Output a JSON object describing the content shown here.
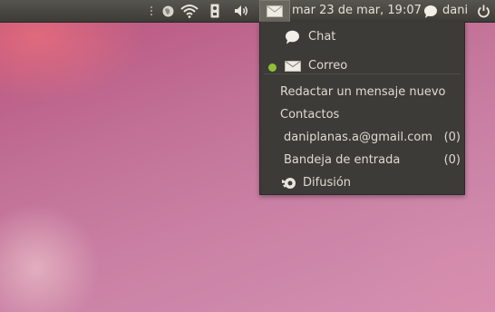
{
  "panel": {
    "indicators": [
      {
        "name": "applet-grip-icon"
      },
      {
        "name": "network-globe-icon"
      },
      {
        "name": "wifi-icon"
      },
      {
        "name": "power-device-icon"
      },
      {
        "name": "volume-icon"
      },
      {
        "name": "mail-envelope-icon"
      }
    ],
    "clock": "mar 23 de mar, 19:07",
    "user": "dani"
  },
  "menu": {
    "chat": "Chat",
    "mail": "Correo",
    "compose": "Redactar un mensaje nuevo",
    "contacts": "Contactos",
    "account": "daniplanas.a@gmail.com",
    "account_count": "(0)",
    "inbox": "Bandeja de entrada",
    "inbox_count": "(0)",
    "broadcast": "Difusión"
  },
  "colors": {
    "panel": "#3d3b37",
    "menu_bg": "#3c3b37",
    "status_dot": "#8fbf35",
    "text": "#dfdbd2"
  }
}
